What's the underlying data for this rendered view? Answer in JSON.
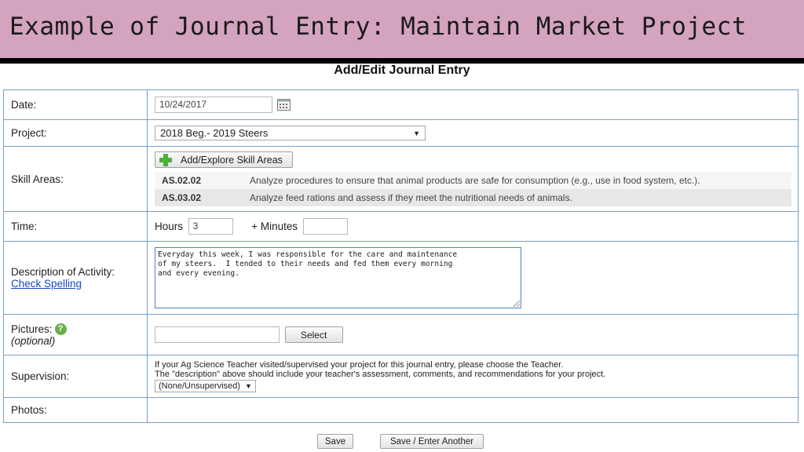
{
  "slide": {
    "title": "Example of Journal Entry: Maintain Market Project"
  },
  "form": {
    "heading": "Add/Edit Journal Entry",
    "date": {
      "label": "Date:",
      "value": "10/24/2017",
      "icon": "calendar-icon"
    },
    "project": {
      "label": "Project:",
      "selected": "2018 Beg.- 2019 Steers"
    },
    "skills": {
      "label": "Skill Areas:",
      "button_label": "Add/Explore Skill Areas",
      "items": [
        {
          "code": "AS.02.02",
          "desc": "Analyze procedures to ensure that animal products are safe for consumption (e.g., use in food system, etc.)."
        },
        {
          "code": "AS.03.02",
          "desc": "Analyze feed rations and assess if they meet the nutritional needs of animals."
        }
      ]
    },
    "time": {
      "label": "Time:",
      "hours_label": "Hours",
      "hours_value": "3",
      "minutes_label": "+ Minutes",
      "minutes_value": ""
    },
    "description": {
      "label": "Description of Activity:",
      "spell_link": "Check Spelling",
      "text": "Everyday this week, I was responsible for the care and maintenance\nof my steers.  I tended to their needs and fed them every morning\nand every evening."
    },
    "pictures": {
      "label": "Pictures:",
      "optional": "(optional)",
      "select_label": "Select",
      "help_icon": "question-icon",
      "help_glyph": "?"
    },
    "supervision": {
      "label": "Supervision:",
      "note1": "If your Ag Science Teacher visited/supervised your project for this journal entry, please choose the Teacher.",
      "note2": "The \"description\" above should include your teacher's assessment, comments, and recommendations for your project.",
      "selected": "(None/Unsupervised)"
    },
    "photos": {
      "label": "Photos:"
    },
    "actions": {
      "save": "Save",
      "save_another": "Save / Enter Another"
    }
  },
  "colors": {
    "banner": "#d4a3c0",
    "border": "#7aa0c4",
    "link": "#1a45c8",
    "accent_green": "#4caf3a"
  }
}
